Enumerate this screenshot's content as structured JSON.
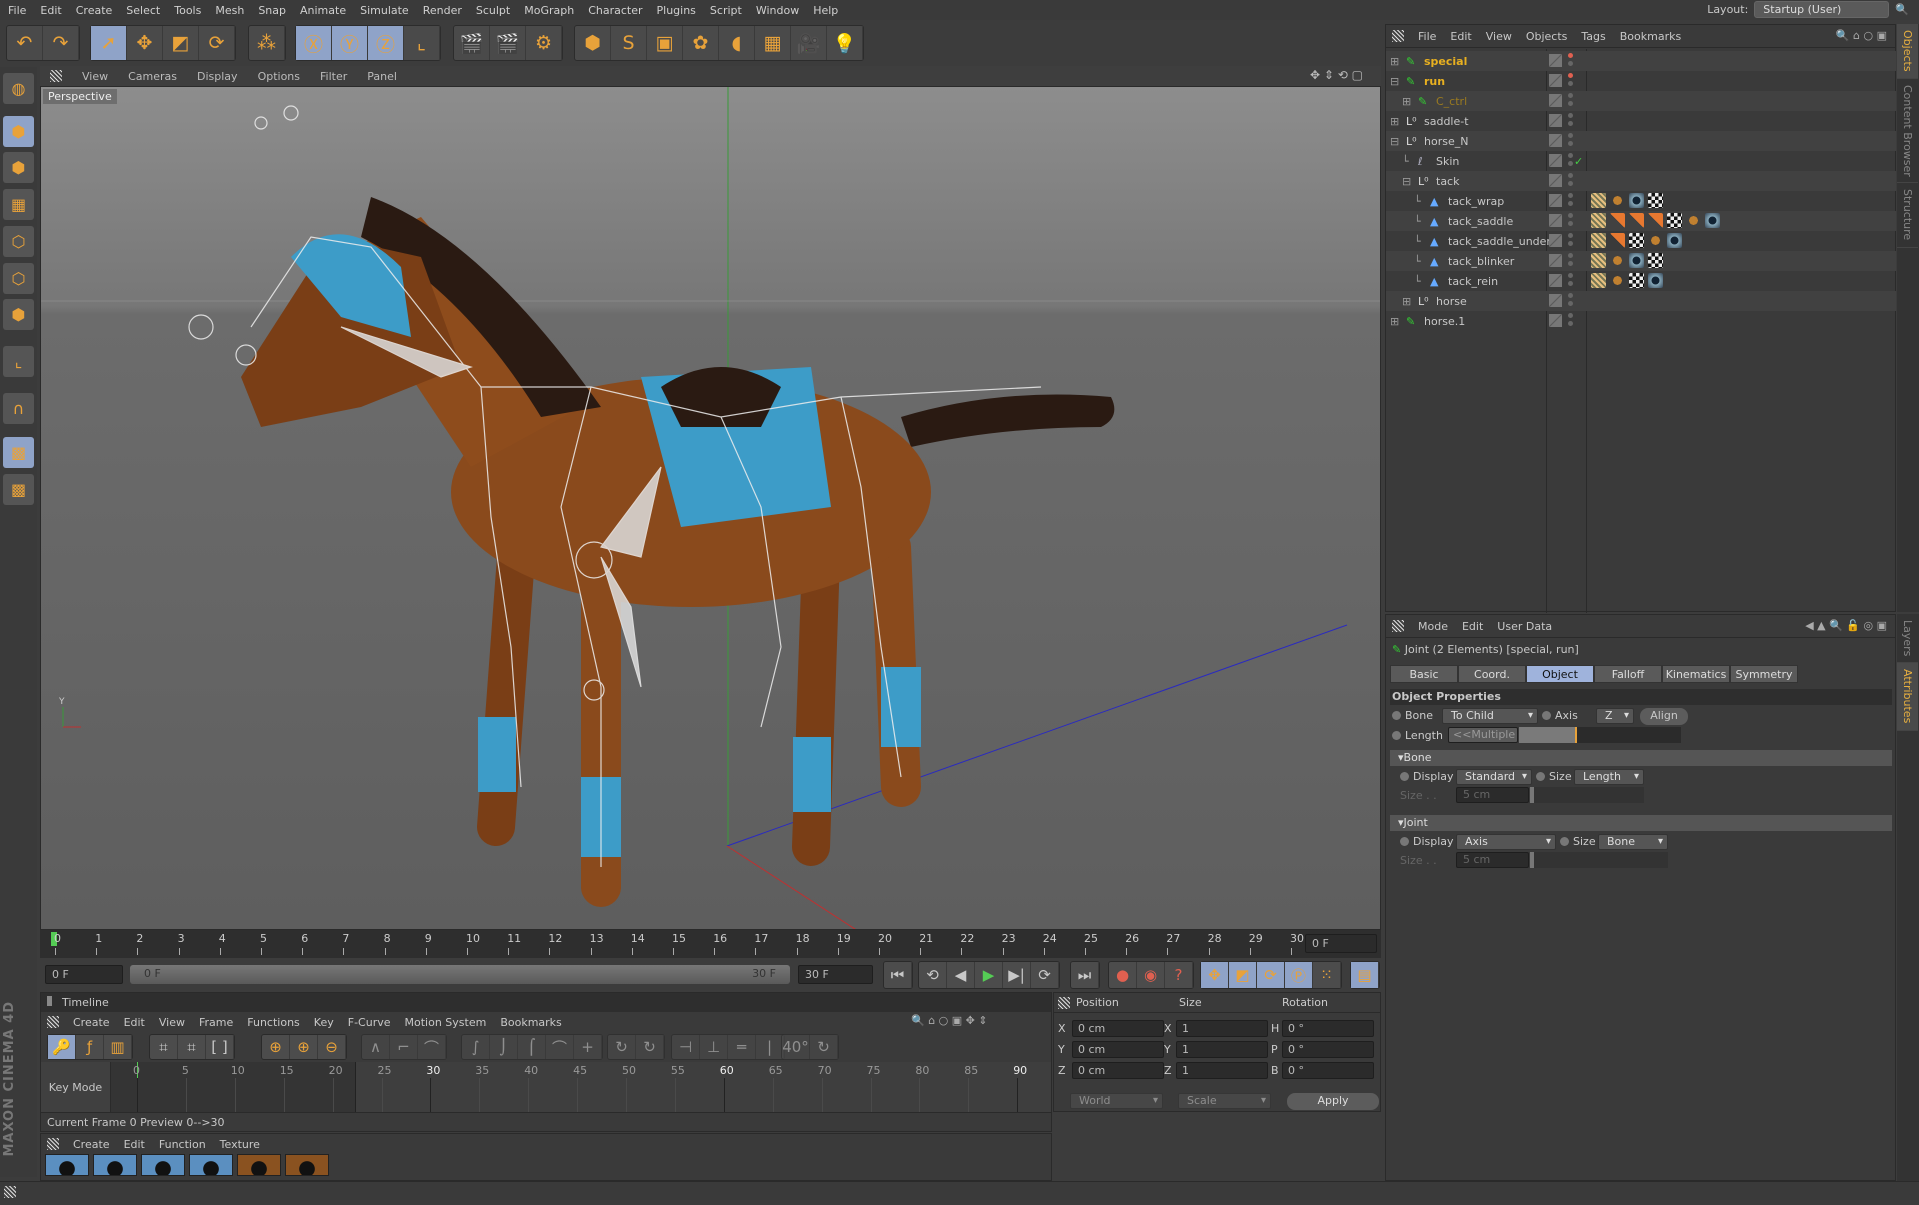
{
  "menu": [
    "File",
    "Edit",
    "Create",
    "Select",
    "Tools",
    "Mesh",
    "Snap",
    "Animate",
    "Simulate",
    "Render",
    "Sculpt",
    "MoGraph",
    "Character",
    "Plugins",
    "Script",
    "Window",
    "Help"
  ],
  "layout": {
    "label": "Layout:",
    "value": "Startup (User)"
  },
  "toolbar_groups": [
    {
      "buttons": [
        {
          "icon": "undo-icon",
          "glyph": "↶"
        },
        {
          "icon": "redo-icon",
          "glyph": "↷"
        }
      ]
    },
    {
      "buttons": [
        {
          "icon": "select-arrow-icon",
          "glyph": "➚",
          "on": true
        },
        {
          "icon": "move-icon",
          "glyph": "✥"
        },
        {
          "icon": "scale-icon",
          "glyph": "◩"
        },
        {
          "icon": "rotate-icon",
          "glyph": "⟳"
        }
      ]
    },
    {
      "buttons": [
        {
          "icon": "live-selection-icon",
          "glyph": "⁂"
        }
      ]
    },
    {
      "buttons": [
        {
          "icon": "x-axis-icon",
          "glyph": "Ⓧ",
          "on": true
        },
        {
          "icon": "y-axis-icon",
          "glyph": "Ⓨ",
          "on": true
        },
        {
          "icon": "z-axis-icon",
          "glyph": "Ⓩ",
          "on": true
        },
        {
          "icon": "coordinate-system-icon",
          "glyph": "⌞"
        }
      ]
    },
    {
      "buttons": [
        {
          "icon": "render-view-icon",
          "glyph": "🎬"
        },
        {
          "icon": "render-picture-viewer-icon",
          "glyph": "🎬"
        },
        {
          "icon": "render-settings-icon",
          "glyph": "⚙"
        }
      ]
    },
    {
      "buttons": [
        {
          "icon": "cube-icon",
          "glyph": "⬢"
        },
        {
          "icon": "spline-pen-icon",
          "glyph": "S"
        },
        {
          "icon": "subdivision-icon",
          "glyph": "▣"
        },
        {
          "icon": "cloner-icon",
          "glyph": "✿"
        },
        {
          "icon": "deformer-icon",
          "glyph": "◖"
        },
        {
          "icon": "floor-icon",
          "glyph": "▦"
        },
        {
          "icon": "camera-icon",
          "glyph": "🎥"
        },
        {
          "icon": "light-icon",
          "glyph": "💡"
        }
      ]
    }
  ],
  "left_tools": [
    {
      "icon": "make-editable-icon",
      "glyph": "◍"
    },
    {
      "icon": "model-mode-icon",
      "glyph": "⬢",
      "on": true
    },
    {
      "icon": "texture-mode-icon",
      "glyph": "⬢"
    },
    {
      "icon": "workplane-icon",
      "glyph": "▦"
    },
    {
      "icon": "points-mode-icon",
      "glyph": "⬡"
    },
    {
      "icon": "edges-mode-icon",
      "glyph": "⬡"
    },
    {
      "icon": "polygons-mode-icon",
      "glyph": "⬢"
    },
    {
      "icon": "axis-mode-icon",
      "glyph": "⌞"
    },
    {
      "icon": "snap-icon",
      "glyph": "∩"
    },
    {
      "icon": "workplane-grid-icon",
      "glyph": "▩",
      "on": true
    },
    {
      "icon": "locked-workplane-icon",
      "glyph": "▩"
    }
  ],
  "viewport": {
    "menu": [
      "View",
      "Cameras",
      "Display",
      "Options",
      "Filter",
      "Panel"
    ],
    "camera_label": "Perspective"
  },
  "ruler": {
    "ticks": [
      0,
      1,
      2,
      3,
      4,
      5,
      6,
      7,
      8,
      9,
      10,
      11,
      12,
      13,
      14,
      15,
      16,
      17,
      18,
      19,
      20,
      21,
      22,
      23,
      24,
      25,
      26,
      27,
      28,
      29,
      30
    ],
    "current_frame": "0 F"
  },
  "range": {
    "start": "0 F",
    "slider_start": "0 F",
    "slider_end": "30 F",
    "end": "30 F"
  },
  "timeline": {
    "title": "Timeline",
    "menu": [
      "Create",
      "Edit",
      "View",
      "Frame",
      "Functions",
      "Key",
      "F-Curve",
      "Motion System",
      "Bookmarks"
    ],
    "mode_label": "Key Mode",
    "ticks": [
      0,
      5,
      10,
      15,
      20,
      25,
      30,
      35,
      40,
      45,
      50,
      55,
      60,
      65,
      70,
      75,
      80,
      85,
      90
    ],
    "status": "Current Frame  0  Preview  0-->30"
  },
  "materials": {
    "menu": [
      "Create",
      "Edit",
      "Function",
      "Texture"
    ],
    "thumbs": [
      "#5b8fc0",
      "#5b8fc0",
      "#5b8fc0",
      "#5b8fc0",
      "#8a5220",
      "#8a5220"
    ]
  },
  "coords": {
    "headers": [
      "Position",
      "Size",
      "Rotation"
    ],
    "rows": [
      {
        "axis": "X",
        "pos": "0 cm",
        "saxis": "X",
        "size": "1",
        "raxis": "H",
        "rot": "0 °"
      },
      {
        "axis": "Y",
        "pos": "0 cm",
        "saxis": "Y",
        "size": "1",
        "raxis": "P",
        "rot": "0 °"
      },
      {
        "axis": "Z",
        "pos": "0 cm",
        "saxis": "Z",
        "size": "1",
        "raxis": "B",
        "rot": "0 °"
      }
    ],
    "space": "World",
    "mode": "Scale",
    "apply": "Apply"
  },
  "objects": {
    "menu": [
      "File",
      "Edit",
      "View",
      "Objects",
      "Tags",
      "Bookmarks"
    ],
    "rows": [
      {
        "name": "special",
        "depth": 0,
        "exp": "+",
        "icon": "joint-icon",
        "color": "#e8b020",
        "dot": "#e06050"
      },
      {
        "name": "run",
        "depth": 0,
        "exp": "-",
        "icon": "joint-icon",
        "color": "#e8b020",
        "dot": "#e06050"
      },
      {
        "name": "C_ctrl",
        "depth": 1,
        "exp": "+",
        "icon": "joint-icon",
        "color": "#9a7a20"
      },
      {
        "name": "saddle-t",
        "depth": 0,
        "exp": "+",
        "icon": "null-icon",
        "color": "#c8c8c8"
      },
      {
        "name": "horse_N",
        "depth": 0,
        "exp": "-",
        "icon": "null-icon",
        "color": "#c8c8c8"
      },
      {
        "name": "Skin",
        "depth": 1,
        "exp": "",
        "icon": "skin-icon",
        "color": "#c8c8c8",
        "check": true
      },
      {
        "name": "tack",
        "depth": 1,
        "exp": "-",
        "icon": "null-icon",
        "color": "#c8c8c8"
      },
      {
        "name": "tack_wrap",
        "depth": 2,
        "exp": "",
        "icon": "polygon-icon",
        "color": "#c8c8c8",
        "tags": [
          "weight",
          "vertex",
          "material",
          "uvw"
        ]
      },
      {
        "name": "tack_saddle",
        "depth": 2,
        "exp": "",
        "icon": "polygon-icon",
        "color": "#c8c8c8",
        "tags": [
          "weight",
          "selection",
          "selection",
          "selection",
          "uvw",
          "vertex",
          "material"
        ]
      },
      {
        "name": "tack_saddle_under",
        "depth": 2,
        "exp": "",
        "icon": "polygon-icon",
        "color": "#c8c8c8",
        "tags": [
          "weight",
          "selection",
          "uvw",
          "vertex",
          "material"
        ]
      },
      {
        "name": "tack_blinker",
        "depth": 2,
        "exp": "",
        "icon": "polygon-icon",
        "color": "#c8c8c8",
        "tags": [
          "weight",
          "vertex",
          "material",
          "uvw"
        ]
      },
      {
        "name": "tack_rein",
        "depth": 2,
        "exp": "",
        "icon": "polygon-icon",
        "color": "#c8c8c8",
        "tags": [
          "weight",
          "vertex",
          "uvw",
          "material"
        ]
      },
      {
        "name": "horse",
        "depth": 1,
        "exp": "+",
        "icon": "null-icon",
        "color": "#c8c8c8"
      },
      {
        "name": "horse.1",
        "depth": 0,
        "exp": "+",
        "icon": "joint-icon",
        "color": "#c8c8c8"
      }
    ]
  },
  "attributes": {
    "menu": [
      "Mode",
      "Edit",
      "User Data"
    ],
    "title": "Joint (2 Elements) [special, run]",
    "tabs": [
      {
        "label": "Basic"
      },
      {
        "label": "Coord."
      },
      {
        "label": "Object",
        "on": true
      },
      {
        "label": "Falloff"
      },
      {
        "label": "Kinematics"
      },
      {
        "label": "Symmetry"
      }
    ],
    "section": "Object Properties",
    "bone_label": "Bone",
    "bone_value": "To Child",
    "axis_label": "Axis",
    "axis_value": "Z",
    "align": "Align",
    "length_label": "Length",
    "length_value": "<<Multiple",
    "bone_group": "Bone",
    "bone_display_label": "Display",
    "bone_display": "Standard",
    "bone_size_label": "Size",
    "bone_size_mode": "Length",
    "bone_size_field_label": "Size . .",
    "bone_size": "5 cm",
    "joint_group": "Joint",
    "joint_display_label": "Display",
    "joint_display": "Axis",
    "joint_size_label": "Size",
    "joint_size_mode": "Bone",
    "joint_size_field_label": "Size . .",
    "joint_size": "5 cm"
  },
  "right_tabs_top": [
    {
      "label": "Objects",
      "on": true
    },
    {
      "label": "Content Browser"
    },
    {
      "label": "Structure"
    }
  ],
  "right_tabs_bottom": [
    {
      "label": "Layers"
    },
    {
      "label": "Attributes",
      "on": true
    }
  ],
  "brand": "MAXON CINEMA 4D",
  "colors": {
    "accent": "#8fa3c8",
    "selected_text": "#e8b020",
    "horse_body": "#8a4a1c",
    "tack_blue": "#3d9cc8"
  }
}
